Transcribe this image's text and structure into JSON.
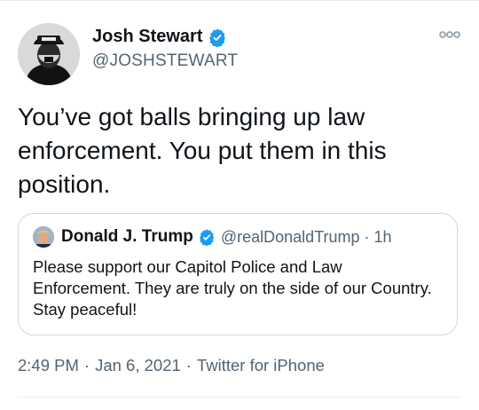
{
  "author": {
    "display_name": "Josh Stewart",
    "handle": "@JOSHSTEWART",
    "verified": true
  },
  "tweet": {
    "text": "You’ve got balls bringing up law enforcement. You put them in this position."
  },
  "quoted_tweet": {
    "display_name": "Donald J. Trump",
    "handle": "@realDonaldTrump",
    "separator": "·",
    "time_ago": "1h",
    "verified": true,
    "text": "Please support our Capitol Police and Law Enforcement. They are truly on the side of our Country. Stay peaceful!"
  },
  "meta": {
    "time": "2:49 PM",
    "dot1": "·",
    "date": "Jan 6, 2021",
    "dot2": "·",
    "source": "Twitter for iPhone"
  },
  "icons": {
    "verified": "verified-badge-icon",
    "more": "more-options-icon"
  },
  "colors": {
    "verified_blue": "#1d9bf0",
    "text_primary": "#0f1419",
    "text_secondary": "#536471",
    "border": "#cfd9de"
  }
}
